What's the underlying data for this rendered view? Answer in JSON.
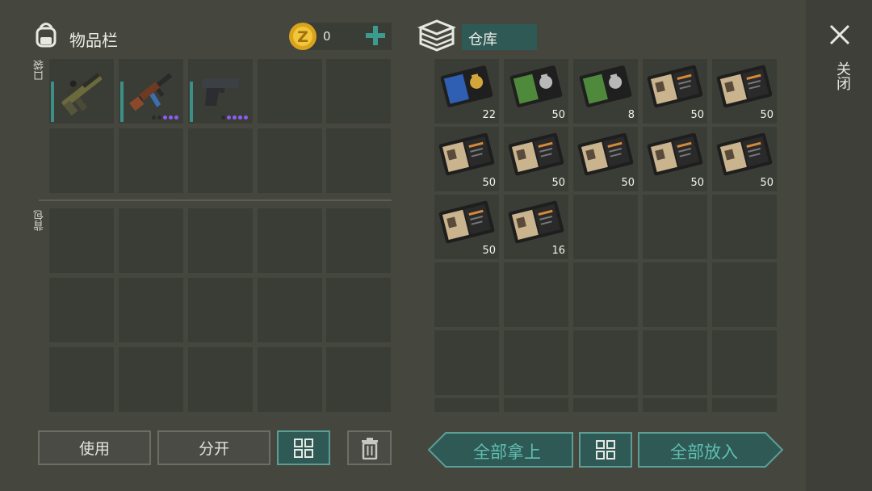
{
  "inventory": {
    "title": "物品栏",
    "coin_amount": "0",
    "pocket_label": "口袋",
    "backpack_label": "背包",
    "pocket_items": [
      {
        "icon": "grenade-launcher-icon",
        "rarity_dots": 0
      },
      {
        "icon": "assault-rifle-icon",
        "rarity_dots": 3
      },
      {
        "icon": "pistol-icon",
        "rarity_dots": 4
      }
    ]
  },
  "storage": {
    "title": "仓库",
    "items": [
      {
        "icon": "blue-badge-id-icon",
        "count": "22"
      },
      {
        "icon": "green-badge-id-icon",
        "count": "50"
      },
      {
        "icon": "green-badge-id-icon",
        "count": "8"
      },
      {
        "icon": "personal-dossier-icon",
        "count": "50"
      },
      {
        "icon": "personal-dossier-icon",
        "count": "50"
      },
      {
        "icon": "personal-dossier-icon",
        "count": "50"
      },
      {
        "icon": "personal-dossier-icon",
        "count": "50"
      },
      {
        "icon": "personal-dossier-icon",
        "count": "50"
      },
      {
        "icon": "personal-dossier-icon",
        "count": "50"
      },
      {
        "icon": "personal-dossier-icon",
        "count": "50"
      },
      {
        "icon": "personal-dossier-icon",
        "count": "50"
      },
      {
        "icon": "personal-dossier-icon",
        "count": "16"
      }
    ]
  },
  "buttons": {
    "use": "使用",
    "split": "分开",
    "take_all": "全部拿上",
    "put_all": "全部放入"
  },
  "close_label": "关闭",
  "colors": {
    "accent": "#3c8f86",
    "rarity": "#8b5cf6",
    "background": "#45473f"
  }
}
